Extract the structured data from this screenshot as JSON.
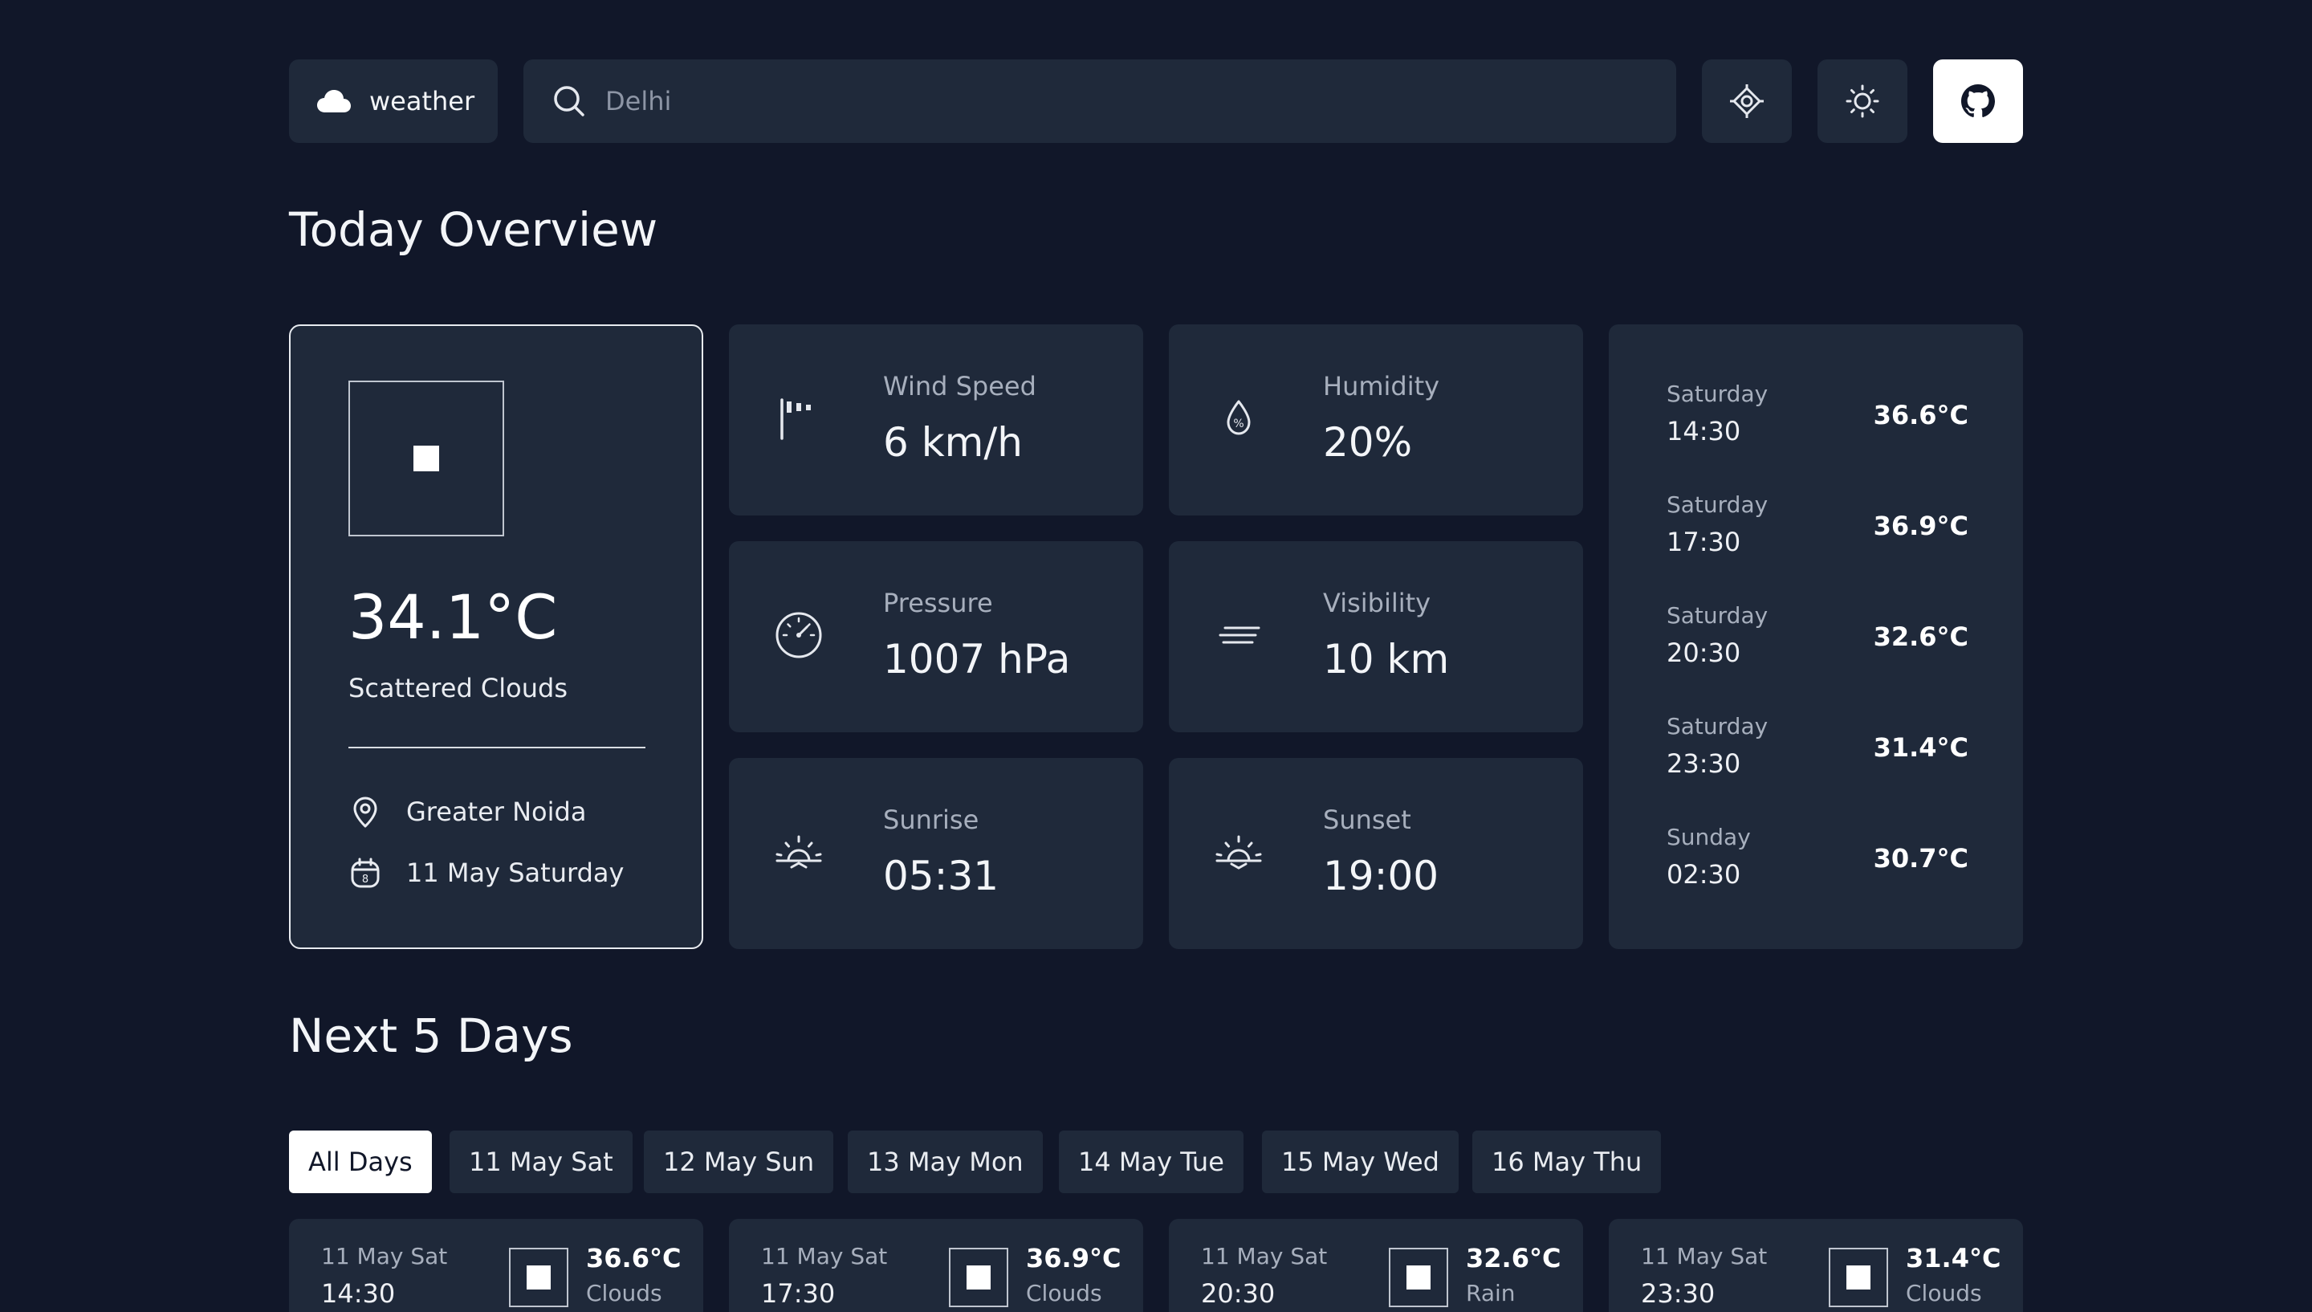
{
  "header": {
    "logo_label": "weather",
    "search_placeholder": "Delhi"
  },
  "overview": {
    "title": "Today Overview",
    "current": {
      "temperature": "34.1°C",
      "description": "Scattered Clouds",
      "location": "Greater Noida",
      "date": "11 May Saturday",
      "calendar_day": "8"
    },
    "metrics": {
      "wind": {
        "label": "Wind Speed",
        "value": "6 km/h"
      },
      "humidity": {
        "label": "Humidity",
        "value": "20%"
      },
      "pressure": {
        "label": "Pressure",
        "value": "1007 hPa"
      },
      "visibility": {
        "label": "Visibility",
        "value": "10 km"
      },
      "sunrise": {
        "label": "Sunrise",
        "value": "05:31"
      },
      "sunset": {
        "label": "Sunset",
        "value": "19:00"
      }
    },
    "hourly": [
      {
        "day": "Saturday",
        "time": "14:30",
        "temp": "36.6°C"
      },
      {
        "day": "Saturday",
        "time": "17:30",
        "temp": "36.9°C"
      },
      {
        "day": "Saturday",
        "time": "20:30",
        "temp": "32.6°C"
      },
      {
        "day": "Saturday",
        "time": "23:30",
        "temp": "31.4°C"
      },
      {
        "day": "Sunday",
        "time": "02:30",
        "temp": "30.7°C"
      }
    ]
  },
  "next_days": {
    "title": "Next 5 Days",
    "tabs": [
      "All Days",
      "11 May Sat",
      "12 May Sun",
      "13 May Mon",
      "14 May Tue",
      "15 May Wed",
      "16 May Thu"
    ],
    "active_tab": "All Days",
    "cards": [
      {
        "date": "11 May Sat",
        "time": "14:30",
        "temp": "36.6°C",
        "desc": "Clouds"
      },
      {
        "date": "11 May Sat",
        "time": "17:30",
        "temp": "36.9°C",
        "desc": "Clouds"
      },
      {
        "date": "11 May Sat",
        "time": "20:30",
        "temp": "32.6°C",
        "desc": "Rain"
      },
      {
        "date": "11 May Sat",
        "time": "23:30",
        "temp": "31.4°C",
        "desc": "Clouds"
      }
    ]
  },
  "theme": {
    "background": "#111729",
    "panel": "#1f293a",
    "accent": "#ffffff"
  }
}
